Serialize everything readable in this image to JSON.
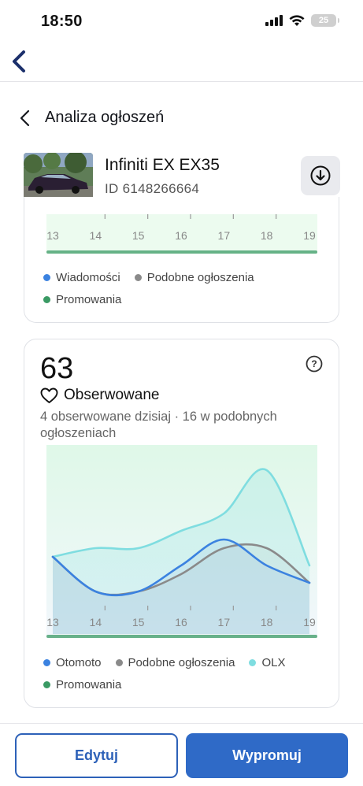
{
  "status_bar": {
    "time": "18:50",
    "battery": "25"
  },
  "header": {
    "title": "Analiza ogłoszeń"
  },
  "listing": {
    "title": "Infiniti EX EX35",
    "id": "ID 6148266664"
  },
  "card_messages": {
    "x_labels": [
      "13",
      "14",
      "15",
      "16",
      "17",
      "18",
      "19"
    ],
    "legend": [
      {
        "label": "Wiadomości",
        "color": "#3b82e0"
      },
      {
        "label": "Podobne ogłoszenia",
        "color": "#8a8a8a"
      },
      {
        "label": "Promowania",
        "color": "#3a9a64"
      }
    ]
  },
  "card_watched": {
    "count": "63",
    "label": "Obserwowane",
    "subtitle": "4 obserwowane dzisiaj · 16 w podobnych ogłoszeniach",
    "legend": [
      {
        "label": "Otomoto",
        "color": "#3b82e0"
      },
      {
        "label": "Podobne ogłoszenia",
        "color": "#8a8a8a"
      },
      {
        "label": "OLX",
        "color": "#7fdde0"
      },
      {
        "label": "Promowania",
        "color": "#3a9a64"
      }
    ]
  },
  "chart_data": {
    "type": "line",
    "x": [
      "13",
      "14",
      "15",
      "16",
      "17",
      "18",
      "19"
    ],
    "series": [
      {
        "name": "Otomoto",
        "color": "#3b82e0",
        "values": [
          4,
          2,
          2,
          3.5,
          5,
          3.5,
          2.5
        ]
      },
      {
        "name": "Podobne ogłoszenia",
        "color": "#8a8a8a",
        "values": [
          4,
          2,
          2,
          3,
          4.5,
          4.5,
          2.5
        ]
      },
      {
        "name": "OLX",
        "color": "#7fdde0",
        "values": [
          4,
          4.5,
          4.5,
          5.5,
          6.5,
          9,
          3.5
        ]
      }
    ],
    "grid": false,
    "legend": "bottom"
  },
  "actions": {
    "edit": "Edytuj",
    "promote": "Wypromuj"
  }
}
